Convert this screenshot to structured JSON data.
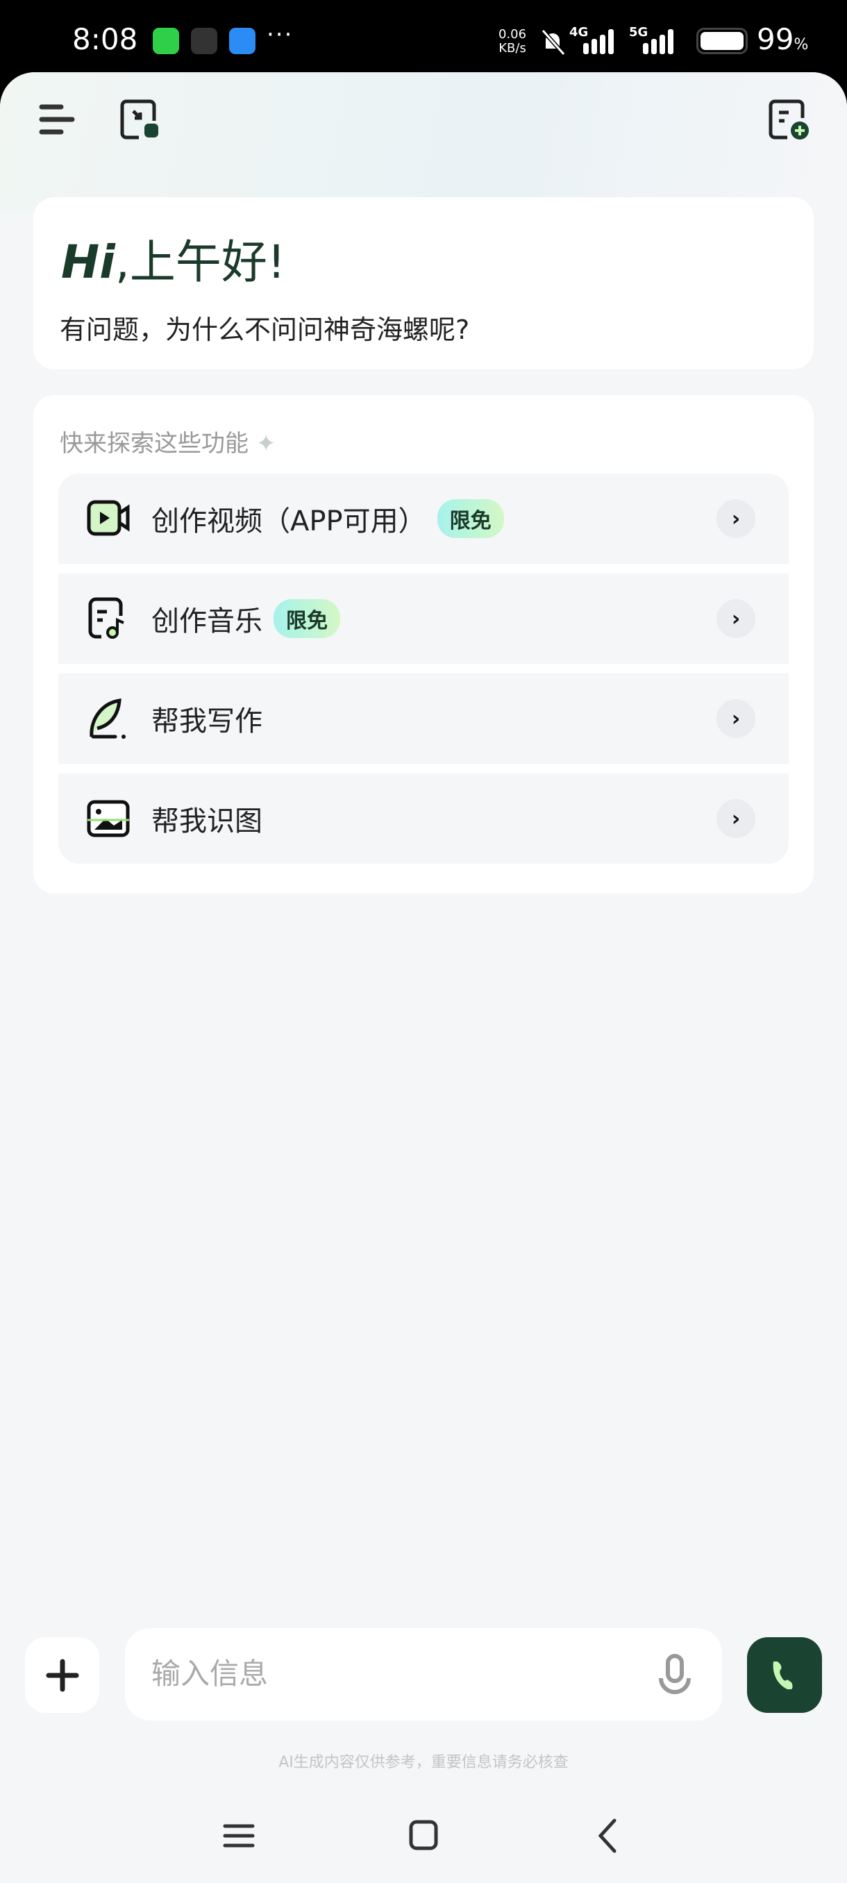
{
  "status_bar": {
    "time": "8:08",
    "net_speed_value": "0.06",
    "net_speed_unit": "KB/s",
    "network1": "4G",
    "network2": "5G",
    "battery": "99",
    "battery_unit": "%",
    "notification_icons": [
      "messages-icon",
      "soul-icon",
      "android-icon"
    ],
    "more": "···"
  },
  "header": {
    "left_icons": [
      "menu-icon",
      "floating-window-icon"
    ],
    "right_icon": "new-chat-icon"
  },
  "greeting": {
    "hi": "Hi",
    "title": ",上午好!",
    "subtitle": "有问题，为什么不问问神奇海螺呢?"
  },
  "explore": {
    "label": "快来探索这些功能",
    "items": [
      {
        "label": "创作视频（APP可用）",
        "badge": "限免",
        "icon": "video-icon"
      },
      {
        "label": "创作音乐",
        "badge": "限免",
        "icon": "music-icon"
      },
      {
        "label": "帮我写作",
        "badge": null,
        "icon": "feather-pen-icon"
      },
      {
        "label": "帮我识图",
        "badge": null,
        "icon": "image-icon"
      }
    ]
  },
  "composer": {
    "placeholder": "输入信息",
    "value": ""
  },
  "disclaimer": "AI生成内容仅供参考，重要信息请务必核查",
  "colors": {
    "brand": "#1a4332",
    "accent": "#c6f7b2"
  }
}
